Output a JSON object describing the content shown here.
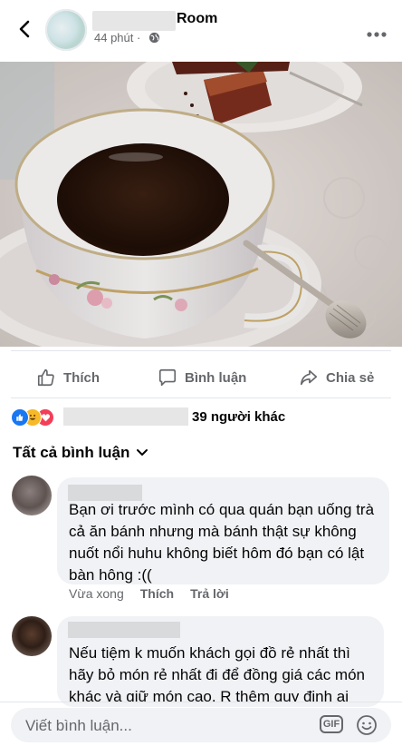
{
  "header": {
    "name_suffix": "Room",
    "time": "44 phút ·",
    "icons": [
      "back-arrow-icon",
      "globe-icon",
      "more-icon"
    ]
  },
  "actions": {
    "like": "Thích",
    "comment": "Bình luận",
    "share": "Chia sẻ"
  },
  "reactions": {
    "others": "39 người khác",
    "icons": [
      "like-reaction-icon",
      "haha-reaction-icon",
      "love-reaction-icon"
    ]
  },
  "comments_header": {
    "label": "Tất cả bình luận"
  },
  "comments": [
    {
      "text": "Bạn ơi trước mình có qua quán bạn uống trà cả ăn bánh nhưng mà bánh thật sự không nuốt nổi huhu không biết hôm đó bạn có lật bàn hông :((",
      "time": "Vừa xong",
      "like": "Thích",
      "reply": "Trả lời"
    },
    {
      "text": "Nếu tiệm k muốn khách gọi đồ rẻ nhất thì hãy bỏ món rẻ nhất đi để đồng giá các món khác và giữ món cao. R thêm quy định ai"
    }
  ],
  "composer": {
    "placeholder": "Viết bình luận...",
    "gif": "GIF"
  },
  "colors": {
    "primary_text": "#050505",
    "secondary_text": "#65676b",
    "bubble": "#f0f2f5",
    "like_blue": "#1877f2",
    "love_red": "#f33e58",
    "haha_yellow": "#f7b928"
  }
}
